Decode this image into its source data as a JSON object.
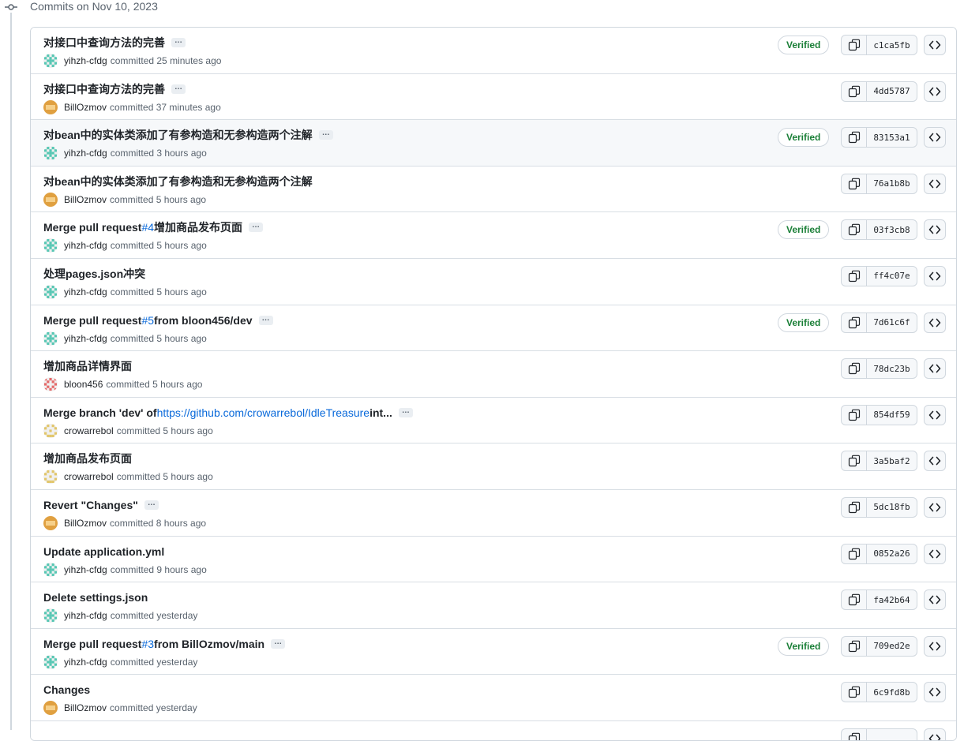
{
  "group": {
    "title": "Commits on Nov 10, 2023"
  },
  "colors": {
    "verified": "#1a7f37",
    "link": "#0969da",
    "border": "#d0d7de"
  },
  "commits": [
    {
      "message": "对接口中查询方法的完善",
      "has_more": true,
      "author": "yihzh-cfdg",
      "avatar": "teal",
      "time": "committed 25 minutes ago",
      "verified": "Verified",
      "sha": "c1ca5fb"
    },
    {
      "message": "对接口中查询方法的完善",
      "has_more": true,
      "author": "BillOzmov",
      "avatar": "orange",
      "time": "committed 37 minutes ago",
      "verified": "",
      "sha": "4dd5787"
    },
    {
      "message": "对bean中的实体类添加了有参构造和无参构造两个注解",
      "has_more": true,
      "author": "yihzh-cfdg",
      "avatar": "teal",
      "time": "committed 3 hours ago",
      "verified": "Verified",
      "sha": "83153a1",
      "highlight": true
    },
    {
      "message": "对bean中的实体类添加了有参构造和无参构造两个注解",
      "has_more": false,
      "author": "BillOzmov",
      "avatar": "orange",
      "time": "committed 5 hours ago",
      "verified": "",
      "sha": "76a1b8b"
    },
    {
      "message_pre": "Merge pull request ",
      "message_link": "#4",
      "message_post": " 增加商品发布页面",
      "has_more": true,
      "author": "yihzh-cfdg",
      "avatar": "teal",
      "time": "committed 5 hours ago",
      "verified": "Verified",
      "sha": "03f3cb8"
    },
    {
      "message": "处理pages.json冲突",
      "has_more": false,
      "author": "yihzh-cfdg",
      "avatar": "teal",
      "time": "committed 5 hours ago",
      "verified": "",
      "sha": "ff4c07e"
    },
    {
      "message_pre": "Merge pull request ",
      "message_link": "#5",
      "message_post": " from bloon456/dev",
      "has_more": true,
      "author": "yihzh-cfdg",
      "avatar": "teal",
      "time": "committed 5 hours ago",
      "verified": "Verified",
      "sha": "7d61c6f"
    },
    {
      "message": "增加商品详情界面",
      "has_more": false,
      "author": "bloon456",
      "avatar": "red",
      "time": "committed 5 hours ago",
      "verified": "",
      "sha": "78dc23b"
    },
    {
      "message_pre": "Merge branch 'dev' of ",
      "message_link": "https://github.com/crowarrebol/IdleTreasure",
      "message_post": " int...",
      "has_more": true,
      "author": "crowarrebol",
      "avatar": "yellow",
      "time": "committed 5 hours ago",
      "verified": "",
      "sha": "854df59"
    },
    {
      "message": "增加商品发布页面",
      "has_more": false,
      "author": "crowarrebol",
      "avatar": "yellow",
      "time": "committed 5 hours ago",
      "verified": "",
      "sha": "3a5baf2"
    },
    {
      "message": "Revert \"Changes\"",
      "has_more": true,
      "author": "BillOzmov",
      "avatar": "orange",
      "time": "committed 8 hours ago",
      "verified": "",
      "sha": "5dc18fb"
    },
    {
      "message": "Update application.yml",
      "has_more": false,
      "author": "yihzh-cfdg",
      "avatar": "teal",
      "time": "committed 9 hours ago",
      "verified": "",
      "sha": "0852a26"
    },
    {
      "message": "Delete settings.json",
      "has_more": false,
      "author": "yihzh-cfdg",
      "avatar": "teal",
      "time": "committed yesterday",
      "verified": "",
      "sha": "fa42b64"
    },
    {
      "message_pre": "Merge pull request ",
      "message_link": "#3",
      "message_post": " from BillOzmov/main",
      "has_more": true,
      "author": "yihzh-cfdg",
      "avatar": "teal",
      "time": "committed yesterday",
      "verified": "Verified",
      "sha": "709ed2e"
    },
    {
      "message": "Changes",
      "has_more": false,
      "author": "BillOzmov",
      "avatar": "orange",
      "time": "committed yesterday",
      "verified": "",
      "sha": "6c9fd8b"
    },
    {
      "message": "",
      "has_more": false,
      "author": "",
      "avatar": "",
      "time": "",
      "verified": "",
      "sha": ""
    }
  ]
}
